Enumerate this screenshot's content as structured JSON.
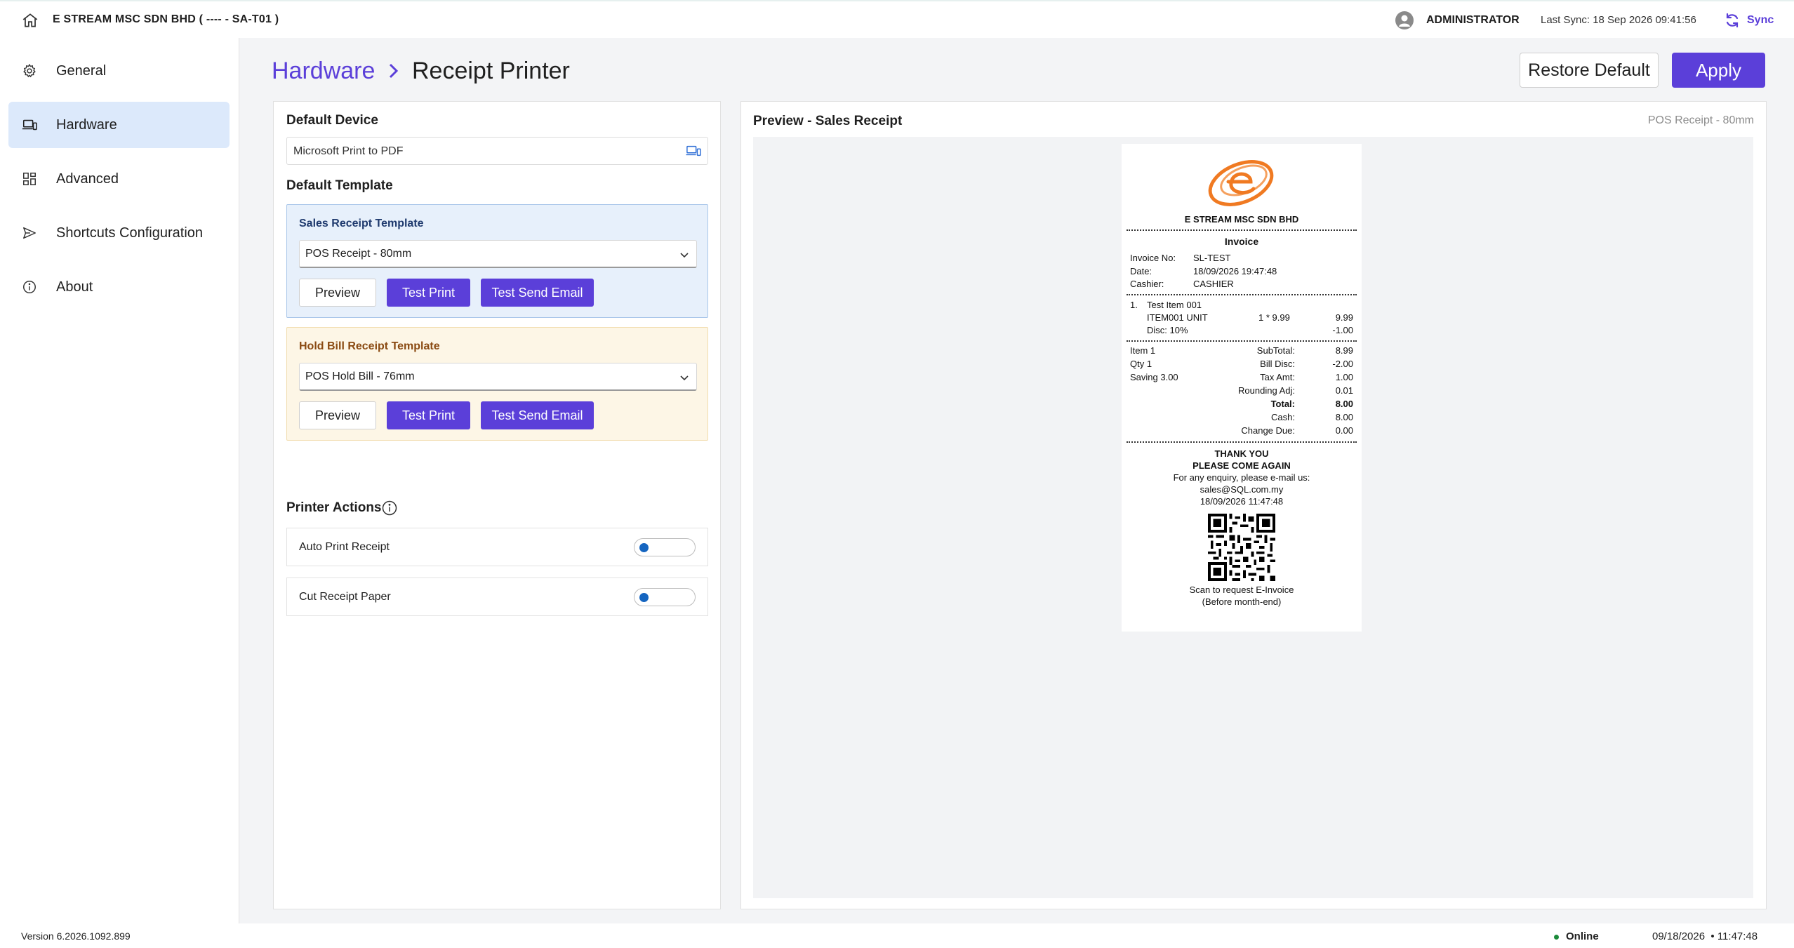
{
  "topbar": {
    "company": "E STREAM MSC SDN BHD ( ---- - SA-T01 )",
    "user": "ADMINISTRATOR",
    "last_sync": "Last Sync: 18 Sep 2026 09:41:56",
    "sync_label": "Sync"
  },
  "sidebar": {
    "items": [
      {
        "label": "General",
        "icon": "gear-icon",
        "active": false
      },
      {
        "label": "Hardware",
        "icon": "laptop-devices-icon",
        "active": true
      },
      {
        "label": "Advanced",
        "icon": "grid-icon",
        "active": false
      },
      {
        "label": "Shortcuts Configuration",
        "icon": "send-icon",
        "active": false
      },
      {
        "label": "About",
        "icon": "info-icon",
        "active": false
      }
    ]
  },
  "header": {
    "breadcrumb_parent": "Hardware",
    "breadcrumb_current": "Receipt Printer",
    "restore_label": "Restore Default",
    "apply_label": "Apply"
  },
  "device": {
    "section_title": "Default Device",
    "value": "Microsoft Print to PDF"
  },
  "templates": {
    "section_title": "Default Template",
    "sales": {
      "title": "Sales Receipt Template",
      "selected": "POS Receipt - 80mm",
      "preview_label": "Preview",
      "test_print_label": "Test Print",
      "test_email_label": "Test Send Email"
    },
    "hold": {
      "title": "Hold Bill Receipt Template",
      "selected": "POS Hold Bill - 76mm",
      "preview_label": "Preview",
      "test_print_label": "Test Print",
      "test_email_label": "Test Send Email"
    }
  },
  "printer_actions": {
    "title": "Printer Actions",
    "auto_print": {
      "label": "Auto Print Receipt",
      "on": false
    },
    "cut_paper": {
      "label": "Cut Receipt Paper",
      "on": false
    }
  },
  "preview": {
    "title": "Preview - Sales Receipt",
    "subtitle": "POS Receipt - 80mm"
  },
  "receipt": {
    "company": "E STREAM MSC SDN BHD",
    "doc_title": "Invoice",
    "invoice_no_label": "Invoice No:",
    "invoice_no": "SL-TEST",
    "date_label": "Date:",
    "date": "18/09/2026 19:47:48",
    "cashier_label": "Cashier:",
    "cashier": "CASHIER",
    "item_index": "1.",
    "item_name": "Test Item 001",
    "item_code": "ITEM001 UNIT",
    "item_qty_price": "1 * 9.99",
    "item_amount": "9.99",
    "item_disc_label": "Disc: 10%",
    "item_disc_amount": "-1.00",
    "summary_left": [
      "Item 1",
      "Qty 1",
      "Saving 3.00"
    ],
    "totals": [
      {
        "label": "SubTotal:",
        "value": "8.99",
        "bold": false
      },
      {
        "label": "Bill Disc:",
        "value": "-2.00",
        "bold": false
      },
      {
        "label": "Tax Amt:",
        "value": "1.00",
        "bold": false
      },
      {
        "label": "Rounding Adj:",
        "value": "0.01",
        "bold": false
      },
      {
        "label": "Total:",
        "value": "8.00",
        "bold": true
      },
      {
        "label": "Cash:",
        "value": "8.00",
        "bold": false
      },
      {
        "label": "Change Due:",
        "value": "0.00",
        "bold": false
      }
    ],
    "thanks_1": "THANK YOU",
    "thanks_2": "PLEASE COME AGAIN",
    "enquiry": "For any enquiry, please e-mail us:",
    "email": "sales@SQL.com.my",
    "timestamp": "18/09/2026 11:47:48",
    "scan_1": "Scan to request E-Invoice",
    "scan_2": "(Before month-end)"
  },
  "footer": {
    "version": "Version 6.2026.1092.899",
    "status": "Online",
    "datetime": "09/18/2026  • 11:47:48"
  },
  "colors": {
    "accent": "#5b3fd9",
    "active_nav": "#dce9fb",
    "sales_template_bg": "#e7f0fb",
    "hold_template_bg": "#fdf6e6",
    "online": "#1b8a3a",
    "logo_orange": "#f07a22"
  }
}
